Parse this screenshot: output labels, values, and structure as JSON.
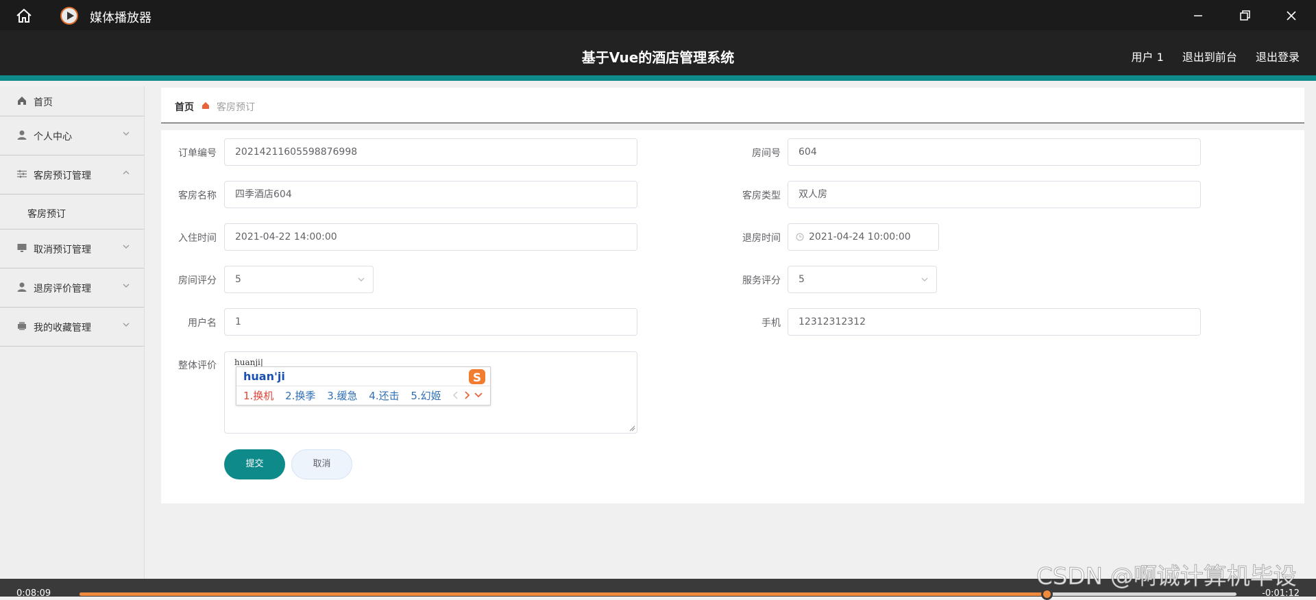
{
  "player": {
    "title": "媒体播放器",
    "elapsed": "0:08:09",
    "remaining": "-0:01:12",
    "progress": 0.8357
  },
  "header": {
    "title": "基于Vue的酒店管理系统",
    "user": "用户 1",
    "exit_front": "退出到前台",
    "logout": "退出登录"
  },
  "sidebar": {
    "home": "首页",
    "personal": "个人中心",
    "booking_mgmt": "客房预订管理",
    "booking": "客房预订",
    "cancel_mgmt": "取消预订管理",
    "review_mgmt": "退房评价管理",
    "favorites": "我的收藏管理"
  },
  "breadcrumb": {
    "home": "首页",
    "current": "客房预订"
  },
  "form": {
    "order_no_label": "订单编号",
    "order_no": "20214211605598876998",
    "room_no_label": "房间号",
    "room_no": "604",
    "room_name_label": "客房名称",
    "room_name": "四季酒店604",
    "room_type_label": "客房类型",
    "room_type": "双人房",
    "checkin_label": "入住时间",
    "checkin": "2021-04-22 14:00:00",
    "checkout_label": "退房时间",
    "checkout": "2021-04-24 10:00:00",
    "room_rating_label": "房间评分",
    "room_rating": "5",
    "service_rating_label": "服务评分",
    "service_rating": "5",
    "username_label": "用户名",
    "username": "1",
    "phone_label": "手机",
    "phone": "12312312312",
    "overall_label": "整体评价",
    "overall": "huanji|",
    "submit": "提交",
    "cancel": "取消"
  },
  "ime": {
    "input": "huan'ji",
    "candidates": [
      "1.换机",
      "2.换季",
      "3.缓急",
      "4.还击",
      "5.幻姬"
    ]
  },
  "watermark": "CSDN @啊诚计算机毕设",
  "colors": {
    "accent": "#0f8a8a",
    "progress": "#f08a3c",
    "header": "#222222"
  }
}
